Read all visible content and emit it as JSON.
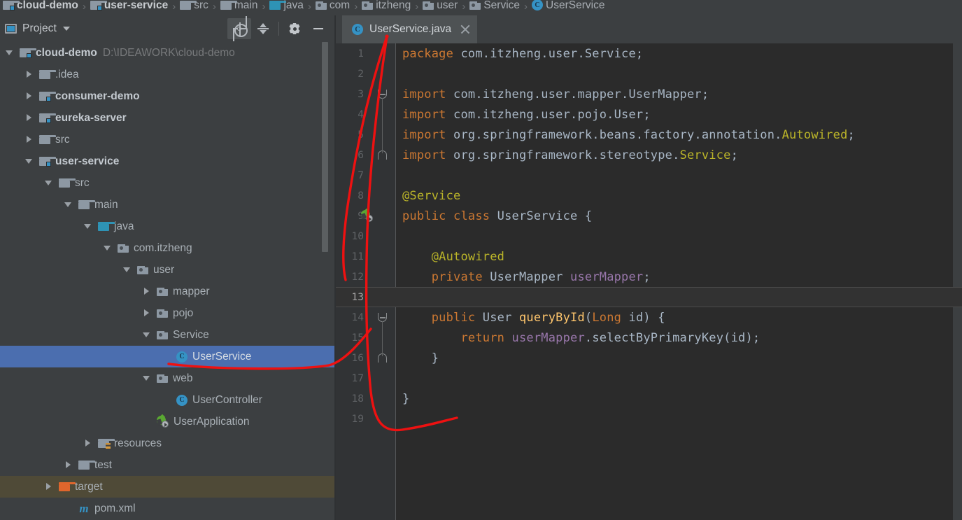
{
  "window": {
    "theme_bg": "#3c3f41",
    "editor_bg": "#2b2b2b",
    "accent_selection": "#4b6eaf",
    "annotation_color": "#ee1111"
  },
  "breadcrumb": {
    "name": "navigation-breadcrumb",
    "items": [
      {
        "label": "cloud-demo",
        "icon": "module-folder-icon",
        "bold": true
      },
      {
        "label": "user-service",
        "icon": "module-folder-icon",
        "bold": true
      },
      {
        "label": "src",
        "icon": "folder-icon",
        "bold": false
      },
      {
        "label": "main",
        "icon": "folder-icon",
        "bold": false
      },
      {
        "label": "java",
        "icon": "source-folder-icon",
        "bold": false
      },
      {
        "label": "com",
        "icon": "package-icon",
        "bold": false
      },
      {
        "label": "itzheng",
        "icon": "package-icon",
        "bold": false
      },
      {
        "label": "user",
        "icon": "package-icon",
        "bold": false
      },
      {
        "label": "Service",
        "icon": "package-icon",
        "bold": false
      },
      {
        "label": "UserService",
        "icon": "class-icon",
        "bold": false
      }
    ],
    "separator": "›"
  },
  "project_panel": {
    "title": "Project",
    "title_icon": "project-window-icon",
    "dropdown_icon": "chevron-down-icon",
    "actions": [
      {
        "name": "locate-in-tree-button",
        "icon": "crosshair-icon",
        "pressed": true
      },
      {
        "name": "collapse-all-button",
        "icon": "collapse-all-icon",
        "pressed": false
      },
      {
        "name": "settings-button",
        "icon": "gear-icon",
        "pressed": false
      },
      {
        "name": "hide-window-button",
        "icon": "minimize-icon",
        "pressed": false
      }
    ],
    "tree": [
      {
        "label": "cloud-demo",
        "path": "D:\\IDEAWORK\\cloud-demo",
        "indent": 0,
        "toggle": "down",
        "icon": "module-folder-icon",
        "bold": true,
        "state": "normal"
      },
      {
        "label": ".idea",
        "path": "",
        "indent": 1,
        "toggle": "right",
        "icon": "folder-icon",
        "bold": false,
        "state": "normal"
      },
      {
        "label": "consumer-demo",
        "path": "",
        "indent": 1,
        "toggle": "right",
        "icon": "module-folder-icon",
        "bold": true,
        "state": "normal"
      },
      {
        "label": "eureka-server",
        "path": "",
        "indent": 1,
        "toggle": "right",
        "icon": "module-folder-icon",
        "bold": true,
        "state": "normal"
      },
      {
        "label": "src",
        "path": "",
        "indent": 1,
        "toggle": "right",
        "icon": "folder-icon",
        "bold": false,
        "state": "normal"
      },
      {
        "label": "user-service",
        "path": "",
        "indent": 1,
        "toggle": "down",
        "icon": "module-folder-icon",
        "bold": true,
        "state": "normal"
      },
      {
        "label": "src",
        "path": "",
        "indent": 2,
        "toggle": "down",
        "icon": "folder-icon",
        "bold": false,
        "state": "normal"
      },
      {
        "label": "main",
        "path": "",
        "indent": 3,
        "toggle": "down",
        "icon": "folder-icon",
        "bold": false,
        "state": "normal"
      },
      {
        "label": "java",
        "path": "",
        "indent": 4,
        "toggle": "down",
        "icon": "source-folder-icon",
        "bold": false,
        "state": "normal"
      },
      {
        "label": "com.itzheng",
        "path": "",
        "indent": 5,
        "toggle": "down",
        "icon": "package-icon",
        "bold": false,
        "state": "normal"
      },
      {
        "label": "user",
        "path": "",
        "indent": 6,
        "toggle": "down",
        "icon": "package-icon",
        "bold": false,
        "state": "normal"
      },
      {
        "label": "mapper",
        "path": "",
        "indent": 7,
        "toggle": "right",
        "icon": "package-icon",
        "bold": false,
        "state": "normal"
      },
      {
        "label": "pojo",
        "path": "",
        "indent": 7,
        "toggle": "right",
        "icon": "package-icon",
        "bold": false,
        "state": "normal"
      },
      {
        "label": "Service",
        "path": "",
        "indent": 7,
        "toggle": "down",
        "icon": "package-icon",
        "bold": false,
        "state": "normal"
      },
      {
        "label": "UserService",
        "path": "",
        "indent": 8,
        "toggle": "none",
        "icon": "class-icon",
        "bold": false,
        "state": "selected"
      },
      {
        "label": "web",
        "path": "",
        "indent": 7,
        "toggle": "down",
        "icon": "package-icon",
        "bold": false,
        "state": "normal"
      },
      {
        "label": "UserController",
        "path": "",
        "indent": 8,
        "toggle": "none",
        "icon": "class-icon",
        "bold": false,
        "state": "normal"
      },
      {
        "label": "UserApplication",
        "path": "",
        "indent": 7,
        "toggle": "none",
        "icon": "spring-boot-class-icon",
        "bold": false,
        "state": "normal"
      },
      {
        "label": "resources",
        "path": "",
        "indent": 4,
        "toggle": "right",
        "icon": "resources-folder-icon",
        "bold": false,
        "state": "normal"
      },
      {
        "label": "test",
        "path": "",
        "indent": 3,
        "toggle": "right",
        "icon": "folder-icon",
        "bold": false,
        "state": "normal"
      },
      {
        "label": "target",
        "path": "",
        "indent": 2,
        "toggle": "right",
        "icon": "excluded-folder-icon",
        "bold": false,
        "state": "excluded"
      },
      {
        "label": "pom.xml",
        "path": "",
        "indent": 3,
        "toggle": "none",
        "icon": "maven-file-icon",
        "bold": false,
        "state": "normal"
      }
    ]
  },
  "editor": {
    "tabs": [
      {
        "label": "UserService.java",
        "icon": "class-icon",
        "close_icon": "close-icon",
        "active": true
      }
    ],
    "caret_line": 13,
    "lines": [
      {
        "n": 1,
        "tokens": [
          {
            "t": "package ",
            "c": "kw"
          },
          {
            "t": "com.itzheng.user.Service;",
            "c": "id"
          }
        ],
        "fold": "",
        "gutter_icon": ""
      },
      {
        "n": 2,
        "tokens": [],
        "fold": "",
        "gutter_icon": ""
      },
      {
        "n": 3,
        "tokens": [
          {
            "t": "import ",
            "c": "kw"
          },
          {
            "t": "com.itzheng.user.mapper.UserMapper;",
            "c": "id"
          }
        ],
        "fold": "open",
        "gutter_icon": ""
      },
      {
        "n": 4,
        "tokens": [
          {
            "t": "import ",
            "c": "kw"
          },
          {
            "t": "com.itzheng.user.pojo.User;",
            "c": "id"
          }
        ],
        "fold": "",
        "gutter_icon": ""
      },
      {
        "n": 5,
        "tokens": [
          {
            "t": "import ",
            "c": "kw"
          },
          {
            "t": "org.springframework.beans.factory.annotation.",
            "c": "id"
          },
          {
            "t": "Autowired",
            "c": "anno"
          },
          {
            "t": ";",
            "c": "id"
          }
        ],
        "fold": "",
        "gutter_icon": ""
      },
      {
        "n": 6,
        "tokens": [
          {
            "t": "import ",
            "c": "kw"
          },
          {
            "t": "org.springframework.stereotype.",
            "c": "id"
          },
          {
            "t": "Service",
            "c": "anno"
          },
          {
            "t": ";",
            "c": "id"
          }
        ],
        "fold": "close",
        "gutter_icon": ""
      },
      {
        "n": 7,
        "tokens": [],
        "fold": "",
        "gutter_icon": ""
      },
      {
        "n": 8,
        "tokens": [
          {
            "t": "@Service",
            "c": "anno"
          }
        ],
        "fold": "",
        "gutter_icon": ""
      },
      {
        "n": 9,
        "tokens": [
          {
            "t": "public class ",
            "c": "kw"
          },
          {
            "t": "UserService ",
            "c": "id"
          },
          {
            "t": "{",
            "c": "br"
          }
        ],
        "fold": "",
        "gutter_icon": "spring-bean-icon"
      },
      {
        "n": 10,
        "tokens": [],
        "fold": "",
        "gutter_icon": ""
      },
      {
        "n": 11,
        "tokens": [
          {
            "t": "    @Autowired",
            "c": "anno"
          }
        ],
        "fold": "",
        "gutter_icon": ""
      },
      {
        "n": 12,
        "tokens": [
          {
            "t": "    private ",
            "c": "kw"
          },
          {
            "t": "UserMapper ",
            "c": "id"
          },
          {
            "t": "userMapper",
            "c": "fld"
          },
          {
            "t": ";",
            "c": "id"
          }
        ],
        "fold": "",
        "gutter_icon": ""
      },
      {
        "n": 13,
        "tokens": [],
        "fold": "",
        "gutter_icon": ""
      },
      {
        "n": 14,
        "tokens": [
          {
            "t": "    public ",
            "c": "kw"
          },
          {
            "t": "User ",
            "c": "id"
          },
          {
            "t": "queryById",
            "c": "mth"
          },
          {
            "t": "(",
            "c": "br"
          },
          {
            "t": "Long ",
            "c": "kw"
          },
          {
            "t": "id",
            "c": "id"
          },
          {
            "t": ") {",
            "c": "br"
          }
        ],
        "fold": "open",
        "gutter_icon": ""
      },
      {
        "n": 15,
        "tokens": [
          {
            "t": "        return ",
            "c": "kw"
          },
          {
            "t": "userMapper",
            "c": "fld"
          },
          {
            "t": ".selectByPrimaryKey(",
            "c": "id"
          },
          {
            "t": "id",
            "c": "id"
          },
          {
            "t": ");",
            "c": "id"
          }
        ],
        "fold": "",
        "gutter_icon": ""
      },
      {
        "n": 16,
        "tokens": [
          {
            "t": "    }",
            "c": "br"
          }
        ],
        "fold": "close",
        "gutter_icon": ""
      },
      {
        "n": 17,
        "tokens": [],
        "fold": "",
        "gutter_icon": ""
      },
      {
        "n": 18,
        "tokens": [
          {
            "t": "}",
            "c": "br"
          }
        ],
        "fold": "",
        "gutter_icon": ""
      },
      {
        "n": 19,
        "tokens": [],
        "fold": "",
        "gutter_icon": ""
      }
    ]
  },
  "annotation": {
    "name": "hand-drawn-arrow",
    "description": "red curved arrow pointing from lower area up to the UserService.java editor tab"
  }
}
